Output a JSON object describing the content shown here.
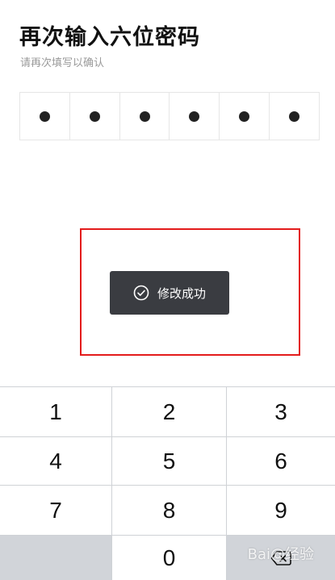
{
  "header": {
    "title": "再次输入六位密码",
    "subtitle": "请再次填写以确认"
  },
  "pin": {
    "length": 6,
    "filled": 6
  },
  "toast": {
    "icon": "check-circle-icon",
    "text": "修改成功"
  },
  "keypad": {
    "keys": [
      "1",
      "2",
      "3",
      "4",
      "5",
      "6",
      "7",
      "8",
      "9",
      "",
      "0",
      ""
    ],
    "delete_icon": "backspace-icon"
  },
  "watermark": {
    "text": "Bai@经验"
  },
  "colors": {
    "highlight_border": "#e31b1b",
    "toast_bg": "#3a3c41",
    "keypad_gray": "#d1d4d9"
  }
}
